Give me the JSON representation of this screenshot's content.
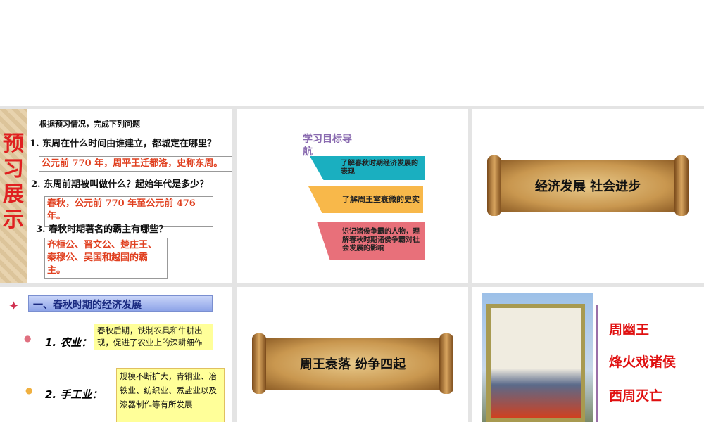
{
  "slides": [
    {
      "side_title": "预习展示",
      "heading": "根据预习情况，完成下列问题",
      "q1": "1. 东周在什么时间由谁建立，都城定在哪里？",
      "a1": "公元前 770 年，周平王迁都洛，史称东周。",
      "q2": "2. 东周前期被叫做什么？起始年代是多少？",
      "a2": "春秋，公元前 770 年至公元前 476 年。",
      "q3": "3. 春秋时期著名的霸主有哪些？",
      "a3": "齐桓公、晋文公、楚庄王、秦穆公、吴国和越国的霸主。"
    },
    {
      "title": "学习目标导航",
      "goals": [
        "了解春秋时期经济发展的表现",
        "了解周王室衰微的史实",
        "识记诸侯争霸的人物，理解春秋时期诸侯争霸对社会发展的影响"
      ],
      "colors": [
        "#1aafc0",
        "#f8b84a",
        "#e8707a"
      ]
    },
    {
      "scroll_text": "经济发展  社会进步"
    },
    {
      "heading": "一、春秋时期的经济发展",
      "item1_label": "1. 农业：",
      "item1_text": "春秋后期，铁制农具和牛耕出现，促进了农业上的深耕细作",
      "item2_label": "2. 手工业：",
      "item2_text": "规模不断扩大，青铜业、冶铁业、纺织业、煮盐业以及漆器制作等有所发展"
    },
    {
      "scroll_text": "周王衰落  纷争四起"
    },
    {
      "lines": [
        "周幽王",
        "烽火戏诸侯",
        "西周灭亡"
      ]
    }
  ]
}
